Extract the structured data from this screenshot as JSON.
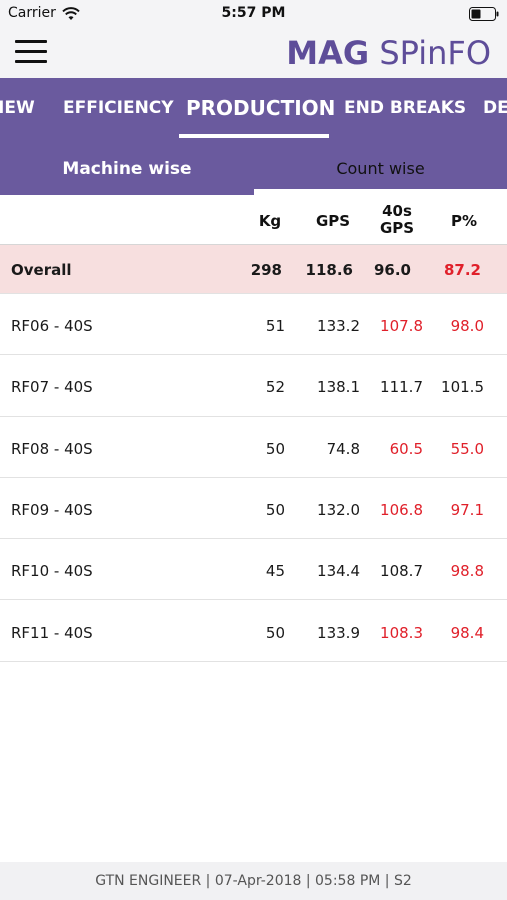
{
  "status_bar": {
    "carrier": "Carrier",
    "time": "5:57 PM",
    "wifi_icon": "wifi-icon",
    "battery_icon": "battery-icon"
  },
  "header": {
    "menu_icon": "hamburger-menu-icon",
    "logo_part1": "MAG",
    "logo_part2": " SPinFO",
    "brand_color": "#5e4d99"
  },
  "tabs": [
    {
      "label": "IEW",
      "active": false
    },
    {
      "label": "EFFICIENCY",
      "active": false
    },
    {
      "label": "PRODUCTION",
      "active": true
    },
    {
      "label": "END BREAKS",
      "active": false
    },
    {
      "label": "DE",
      "active": false
    }
  ],
  "segments": {
    "machine_wise": "Machine wise",
    "count_wise": "Count wise",
    "selected": "machine_wise"
  },
  "table": {
    "columns": [
      "Kg",
      "GPS",
      "40s\nGPS",
      "P%"
    ],
    "col_40s_line1": "40s",
    "col_40s_line2": "GPS",
    "overall": {
      "label": "Overall",
      "kg": "298",
      "gps": "118.6",
      "gps40": "96.0",
      "p": "87.2",
      "p_red": true
    },
    "rows": [
      {
        "label": "RF06 - 40S",
        "kg": "51",
        "gps": "133.2",
        "gps40": "107.8",
        "p": "98.0",
        "gps40_red": true,
        "p_red": true
      },
      {
        "label": "RF07 - 40S",
        "kg": "52",
        "gps": "138.1",
        "gps40": "111.7",
        "p": "101.5",
        "gps40_red": false,
        "p_red": false
      },
      {
        "label": "RF08 - 40S",
        "kg": "50",
        "gps": "74.8",
        "gps40": "60.5",
        "p": "55.0",
        "gps40_red": true,
        "p_red": true
      },
      {
        "label": "RF09 - 40S",
        "kg": "50",
        "gps": "132.0",
        "gps40": "106.8",
        "p": "97.1",
        "gps40_red": true,
        "p_red": true
      },
      {
        "label": "RF10 - 40S",
        "kg": "45",
        "gps": "134.4",
        "gps40": "108.7",
        "p": "98.8",
        "gps40_red": false,
        "p_red": true
      },
      {
        "label": "RF11 - 40S",
        "kg": "50",
        "gps": "133.9",
        "gps40": "108.3",
        "p": "98.4",
        "gps40_red": true,
        "p_red": true
      }
    ]
  },
  "footer": {
    "text": "GTN ENGINEER | 07-Apr-2018 | 05:58 PM | S2"
  },
  "colors": {
    "accent": "#6a5a9e",
    "alert_red": "#e0202a",
    "overall_bg": "#f7dfdf"
  }
}
